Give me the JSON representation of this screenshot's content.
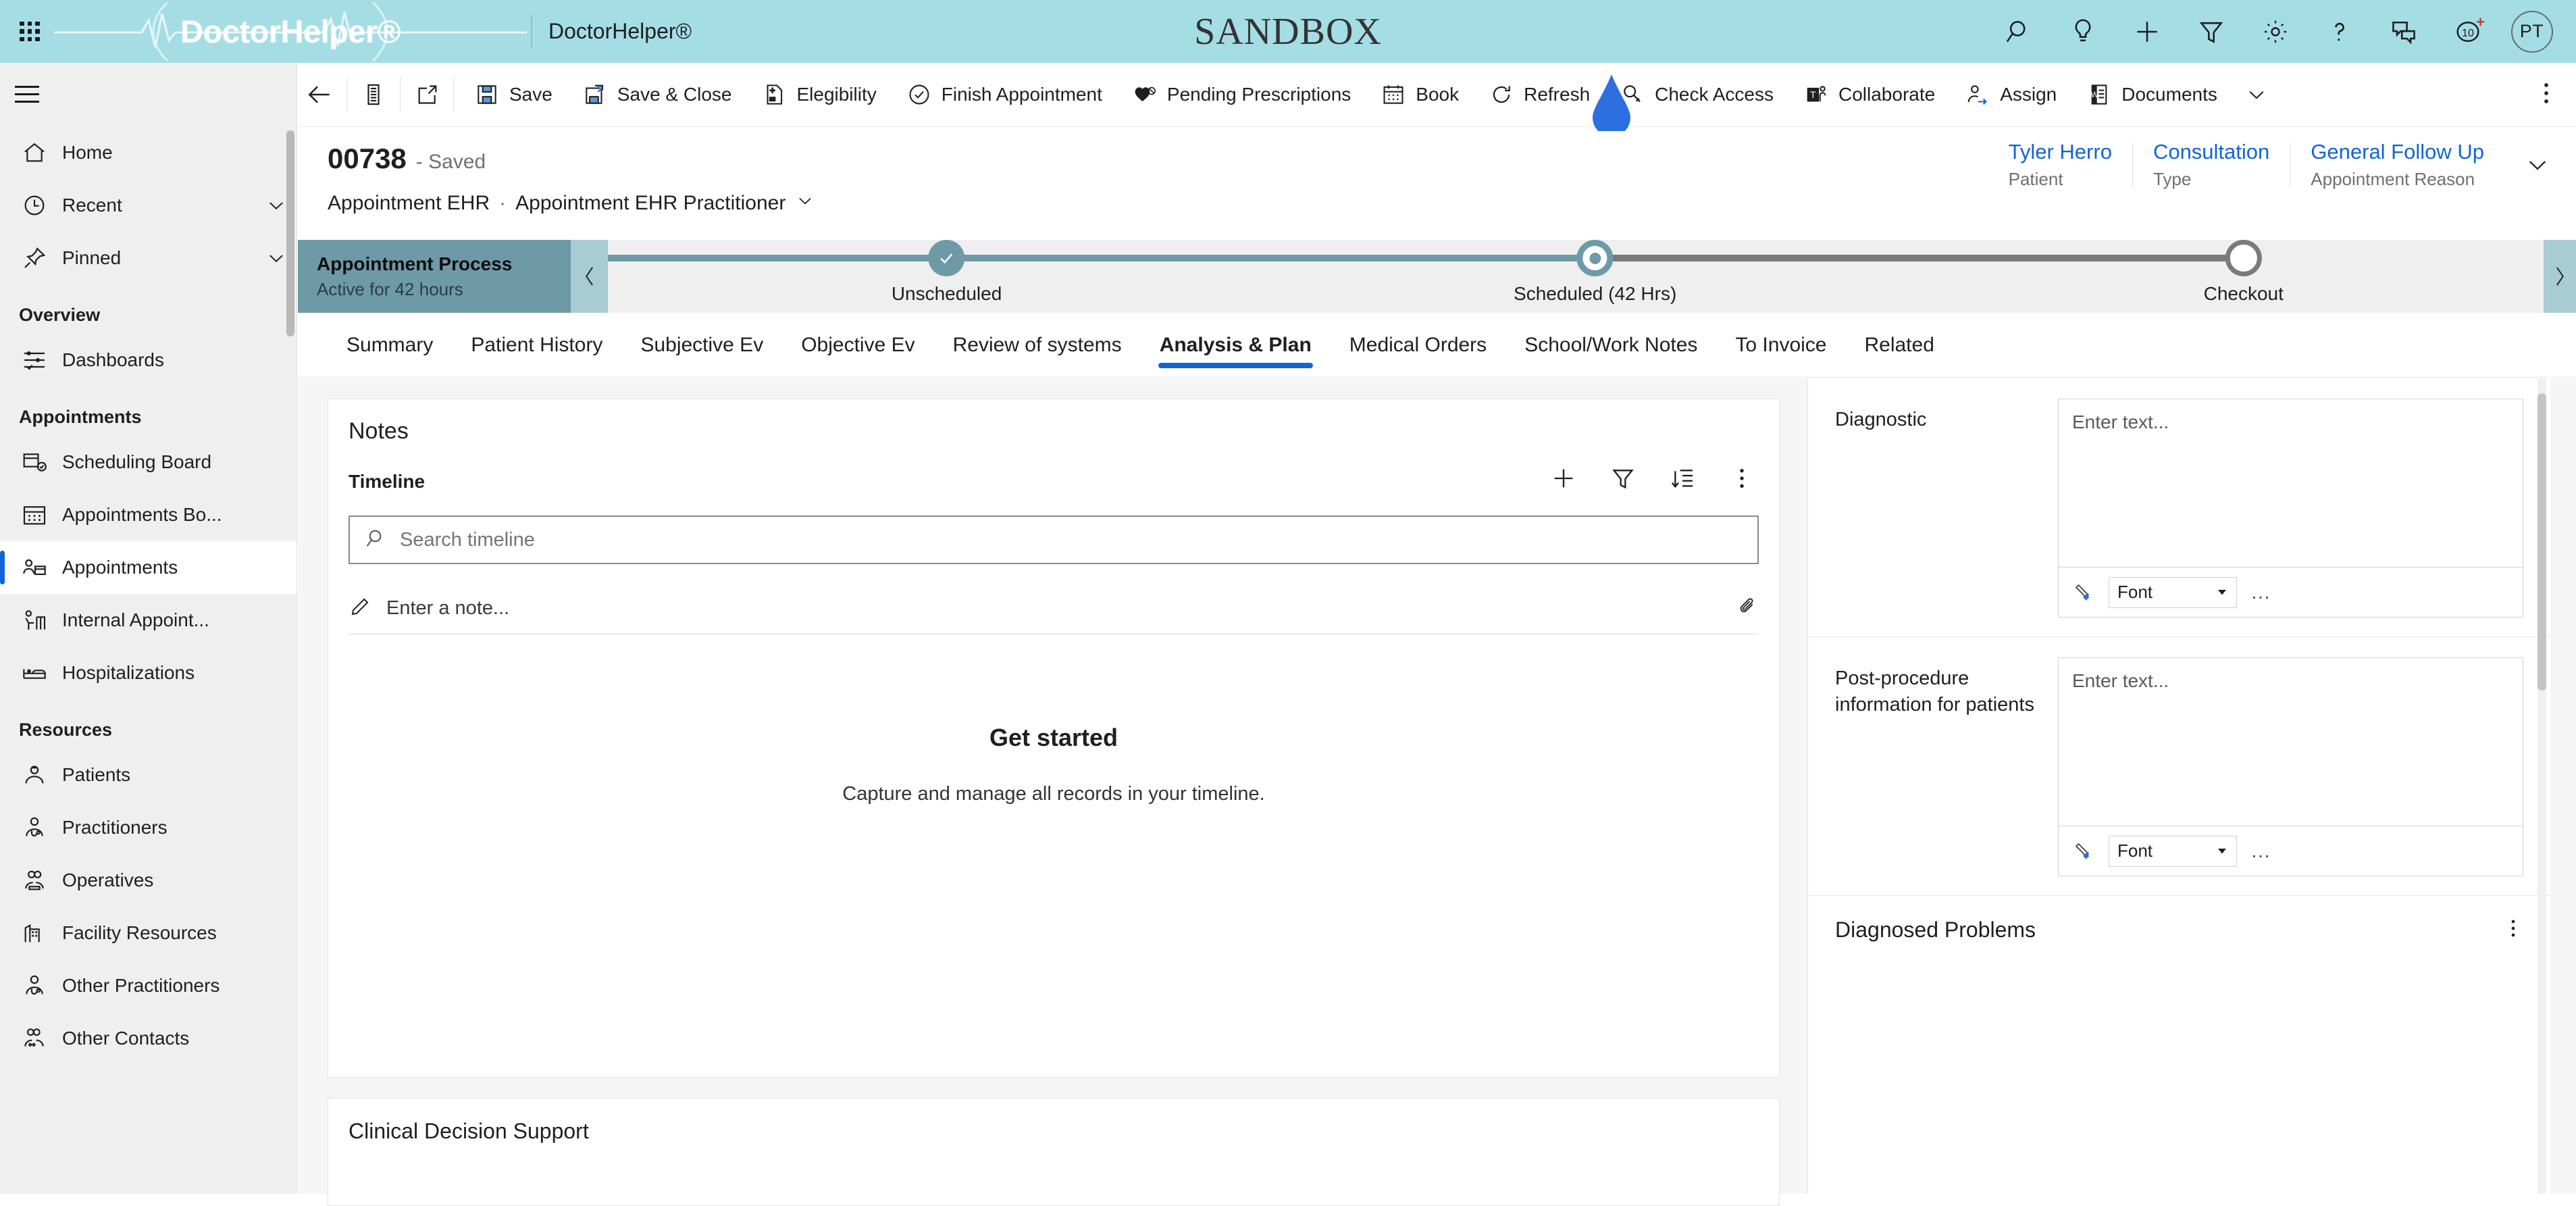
{
  "topbar": {
    "waffle_label": "app-launcher",
    "brand_wordmark": "DoctorHelper®",
    "app_name": "DoctorHelper®",
    "environment": "SANDBOX",
    "icons": [
      {
        "name": "search-icon",
        "label": "Search"
      },
      {
        "name": "lightbulb-icon",
        "label": "Ideas"
      },
      {
        "name": "plus-icon",
        "label": "Quick create"
      },
      {
        "name": "filter-icon",
        "label": "Filter"
      },
      {
        "name": "gear-icon",
        "label": "Settings"
      },
      {
        "name": "question-icon",
        "label": "Help"
      },
      {
        "name": "chat-icon",
        "label": "Chat"
      },
      {
        "name": "notifications-icon",
        "label": "Notifications",
        "badge_count": "10",
        "badge_plus": "+"
      }
    ],
    "avatar_initials": "PT"
  },
  "sidebar": {
    "hamburger_label": "Expand navigation",
    "quick": [
      {
        "label": "Home",
        "icon": "home-icon",
        "chevron": false
      },
      {
        "label": "Recent",
        "icon": "clock-icon",
        "chevron": true
      },
      {
        "label": "Pinned",
        "icon": "pin-icon",
        "chevron": true
      }
    ],
    "groups": [
      {
        "title": "Overview",
        "items": [
          {
            "label": "Dashboards",
            "icon": "dashboard-icon",
            "selected": false
          }
        ]
      },
      {
        "title": "Appointments",
        "items": [
          {
            "label": "Scheduling Board",
            "icon": "calendar-check-icon",
            "selected": false
          },
          {
            "label": "Appointments Bo...",
            "icon": "calendar-icon",
            "selected": false
          },
          {
            "label": "Appointments",
            "icon": "appointment-person-icon",
            "selected": true
          },
          {
            "label": "Internal Appoint...",
            "icon": "internal-appointment-icon",
            "selected": false
          },
          {
            "label": "Hospitalizations",
            "icon": "bed-icon",
            "selected": false
          }
        ]
      },
      {
        "title": "Resources",
        "items": [
          {
            "label": "Patients",
            "icon": "patient-icon",
            "selected": false
          },
          {
            "label": "Practitioners",
            "icon": "practitioner-icon",
            "selected": false
          },
          {
            "label": "Operatives",
            "icon": "operatives-icon",
            "selected": false
          },
          {
            "label": "Facility Resources",
            "icon": "building-icon",
            "selected": false
          },
          {
            "label": "Other Practitioners",
            "icon": "other-practitioner-icon",
            "selected": false
          },
          {
            "label": "Other Contacts",
            "icon": "other-contacts-icon",
            "selected": false
          }
        ]
      }
    ]
  },
  "commandbar": {
    "back_label": "Back",
    "show_chart_label": "Show Chart",
    "open_form_label": "Open Form",
    "buttons": [
      {
        "label": "Save",
        "icon": "save-icon"
      },
      {
        "label": "Save & Close",
        "icon": "save-close-icon"
      },
      {
        "label": "Elegibility",
        "icon": "document-icon"
      },
      {
        "label": "Finish Appointment",
        "icon": "check-circle-icon"
      },
      {
        "label": "Pending Prescriptions",
        "icon": "prescription-icon"
      },
      {
        "label": "Book",
        "icon": "calendar-icon"
      },
      {
        "label": "Refresh",
        "icon": "refresh-icon"
      },
      {
        "label": "Check Access",
        "icon": "key-icon"
      },
      {
        "label": "Collaborate",
        "icon": "teams-icon"
      },
      {
        "label": "Assign",
        "icon": "assign-person-icon"
      },
      {
        "label": "Documents",
        "icon": "word-doc-icon"
      }
    ],
    "more_chevron_label": "More commands",
    "overflow_label": "More"
  },
  "record": {
    "number": "00738",
    "status": "- Saved",
    "entity": "Appointment EHR",
    "separator": "·",
    "form_name": "Appointment EHR Practitioner",
    "form_chevron_label": "Change form",
    "fields": [
      {
        "value": "Tyler Herro",
        "label": "Patient"
      },
      {
        "value": "Consultation",
        "label": "Type"
      },
      {
        "value": "General Follow Up",
        "label": "Appointment Reason"
      }
    ],
    "expand_chevron_label": "Expand header"
  },
  "process": {
    "title": "Appointment Process",
    "subtitle": "Active for 42 hours",
    "prev_label": "Previous stage",
    "next_label": "Next stage",
    "stages": [
      {
        "label": "Unscheduled",
        "detail": "",
        "state": "done",
        "pos": 17.5
      },
      {
        "label": "Scheduled",
        "detail": "(42 Hrs)",
        "state": "active",
        "pos": 51.0
      },
      {
        "label": "Checkout",
        "detail": "",
        "state": "todo",
        "pos": 84.5
      }
    ]
  },
  "tabs": [
    {
      "label": "Summary",
      "active": false
    },
    {
      "label": "Patient History",
      "active": false
    },
    {
      "label": "Subjective Ev",
      "active": false
    },
    {
      "label": "Objective Ev",
      "active": false
    },
    {
      "label": "Review of systems",
      "active": false
    },
    {
      "label": "Analysis & Plan",
      "active": true
    },
    {
      "label": "Medical Orders",
      "active": false
    },
    {
      "label": "School/Work Notes",
      "active": false
    },
    {
      "label": "To Invoice",
      "active": false
    },
    {
      "label": "Related",
      "active": false
    }
  ],
  "notes": {
    "card_title": "Notes",
    "timeline_title": "Timeline",
    "tools": [
      {
        "name": "add-icon",
        "label": "Create a timeline record"
      },
      {
        "name": "filter-icon",
        "label": "Filter timeline"
      },
      {
        "name": "sort-icon",
        "label": "Sort"
      },
      {
        "name": "kebab-icon",
        "label": "More commands"
      }
    ],
    "search_placeholder": "Search timeline",
    "note_placeholder": "Enter a note...",
    "attach_label": "Add attachment",
    "empty_heading": "Get started",
    "empty_text": "Capture and manage all records in your timeline."
  },
  "clinical": {
    "title": "Clinical Decision Support"
  },
  "rightpanel": {
    "sections": [
      {
        "label": "Diagnostic",
        "placeholder": "Enter text...",
        "font_label": "Font",
        "brush_label": "Format painter",
        "more_label": "More options"
      },
      {
        "label": "Post-procedure information for patients",
        "placeholder": "Enter text...",
        "font_label": "Font",
        "brush_label": "Format painter",
        "more_label": "More options"
      }
    ],
    "diagnosed_problems": {
      "title": "Diagnosed Problems",
      "kebab_label": "More commands"
    }
  },
  "colors": {
    "brand_bar": "#a5dde5",
    "accent_blue": "#1264d6",
    "process_teal": "#6e9aa8",
    "process_head": "#6e9aa8",
    "sidebar_bg": "#efefef",
    "canvas_bg": "#f5f5f5"
  }
}
